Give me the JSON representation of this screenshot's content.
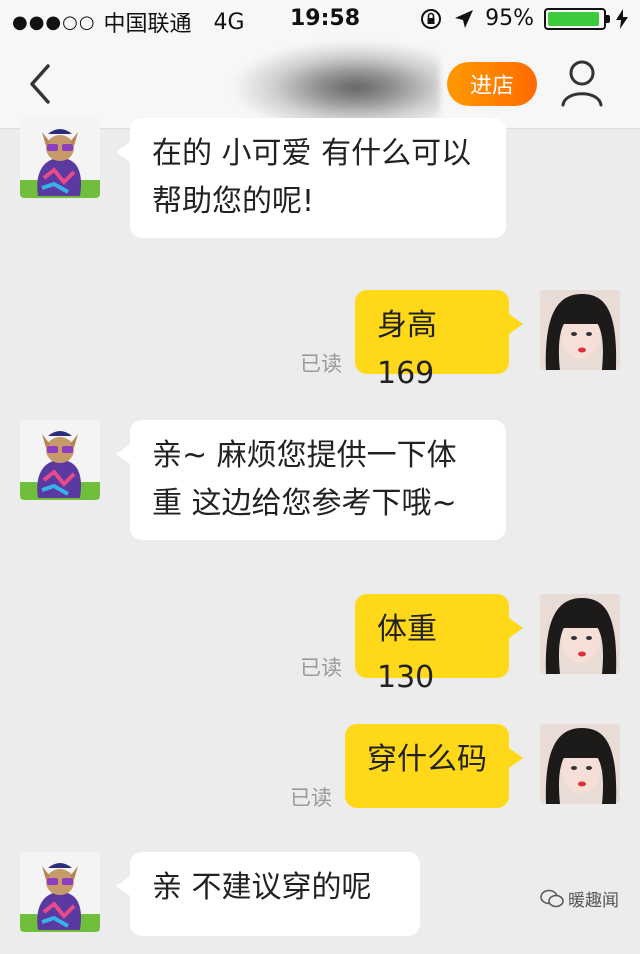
{
  "status_bar": {
    "signal_dots": "●●●○○",
    "carrier": "中国联通",
    "network": "4G",
    "time": "19:58",
    "battery_percent": "95%",
    "battery_level": 0.95,
    "icons": [
      "rotation-lock-icon",
      "location-arrow-icon",
      "battery-icon",
      "charging-bolt-icon"
    ]
  },
  "nav": {
    "enter_shop_label": "进店",
    "accent_color": "#ff8800"
  },
  "messages": [
    {
      "side": "left",
      "text_lines": [
        "在的 小可爱 有什么可以",
        "帮助您的呢!"
      ]
    },
    {
      "side": "right",
      "text_lines": [
        "身高169"
      ],
      "status": "已读"
    },
    {
      "side": "left",
      "text_lines": [
        "亲~ 麻烦您提供一下体",
        "重  这边给您参考下哦~"
      ]
    },
    {
      "side": "right",
      "text_lines": [
        "体重130"
      ],
      "status": "已读"
    },
    {
      "side": "right",
      "text_lines": [
        "穿什么码"
      ],
      "status": "已读"
    },
    {
      "side": "left",
      "text_lines": [
        "亲   不建议穿的呢"
      ]
    }
  ],
  "watermark": {
    "text": "暖趣闻"
  },
  "colors": {
    "bubble_right": "#ffd81a",
    "bubble_left": "#ffffff",
    "background": "#ececec"
  }
}
